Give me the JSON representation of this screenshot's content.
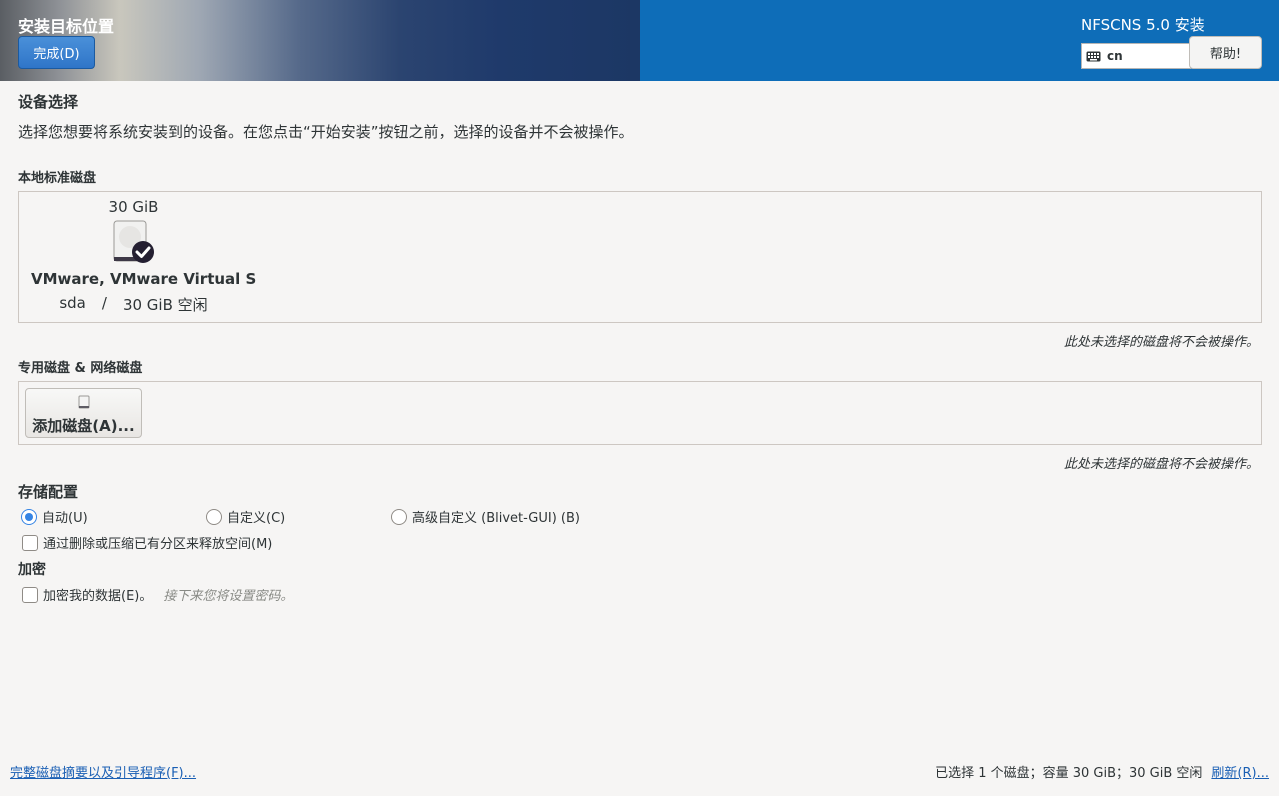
{
  "header": {
    "page_title": "安装目标位置",
    "done_label": "完成(D)",
    "product_title": "NFSCNS 5.0 安装",
    "keyboard_layout": "cn",
    "help_label": "帮助!"
  },
  "device_selection": {
    "heading": "设备选择",
    "description": "选择您想要将系统安装到的设备。在您点击“开始安装”按钮之前，选择的设备并不会被操作。"
  },
  "local_disks": {
    "heading": "本地标准磁盘",
    "disks": [
      {
        "size": "30 GiB",
        "name": "VMware, VMware Virtual S",
        "device": "sda",
        "separator": "/",
        "free": "30 GiB 空闲",
        "selected": true
      }
    ],
    "note": "此处未选择的磁盘将不会被操作。"
  },
  "special_disks": {
    "heading": "专用磁盘 & 网络磁盘",
    "add_label": "添加磁盘(A)...",
    "note": "此处未选择的磁盘将不会被操作。"
  },
  "storage_config": {
    "heading": "存储配置",
    "options": [
      {
        "label": "自动(U)",
        "checked": true
      },
      {
        "label": "自定义(C)",
        "checked": false
      },
      {
        "label": "高级自定义 (Blivet-GUI) (B)",
        "checked": false
      }
    ],
    "reclaim_label": "通过删除或压缩已有分区来释放空间(M)"
  },
  "encryption": {
    "heading": "加密",
    "encrypt_label": "加密我的数据(E)。",
    "hint": "接下来您将设置密码。"
  },
  "footer": {
    "summary_link": "完整磁盘摘要以及引导程序(F)...",
    "status": "已选择 1 个磁盘；容量 30 GiB；30 GiB 空闲",
    "refresh_label": "刷新(R)..."
  },
  "colors": {
    "header_blue": "#0e6db8",
    "accent": "#3584e4",
    "link": "#1a5fb4"
  }
}
